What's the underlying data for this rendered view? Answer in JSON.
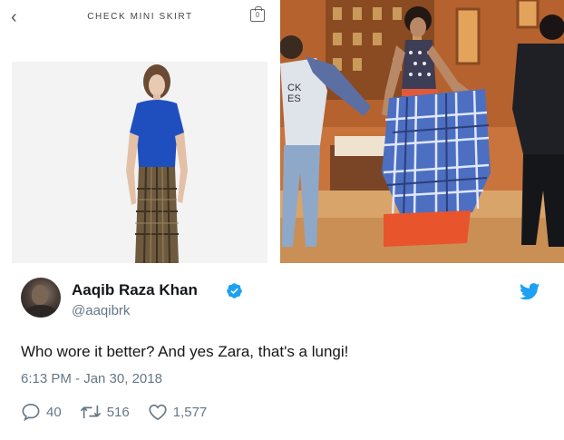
{
  "media": {
    "left": {
      "shop_title": "CHECK MINI SKIRT",
      "back_icon": "chevron-left-icon",
      "bag_icon": "shopping-bag-icon",
      "bag_count": "0"
    },
    "right": {
      "shirt_text": "CK\nES"
    }
  },
  "tweet": {
    "author_name": "Aaqib Raza Khan",
    "handle": "@aaqibrk",
    "text": "Who wore it better? And yes Zara, that's a lungi!",
    "timestamp": "6:13 PM - Jan 30, 2018",
    "replies": "40",
    "retweets": "516",
    "likes": "1,577",
    "colors": {
      "verified": "#1da1f2",
      "twitter_brand": "#1da1f2",
      "secondary_text": "#657786"
    }
  }
}
